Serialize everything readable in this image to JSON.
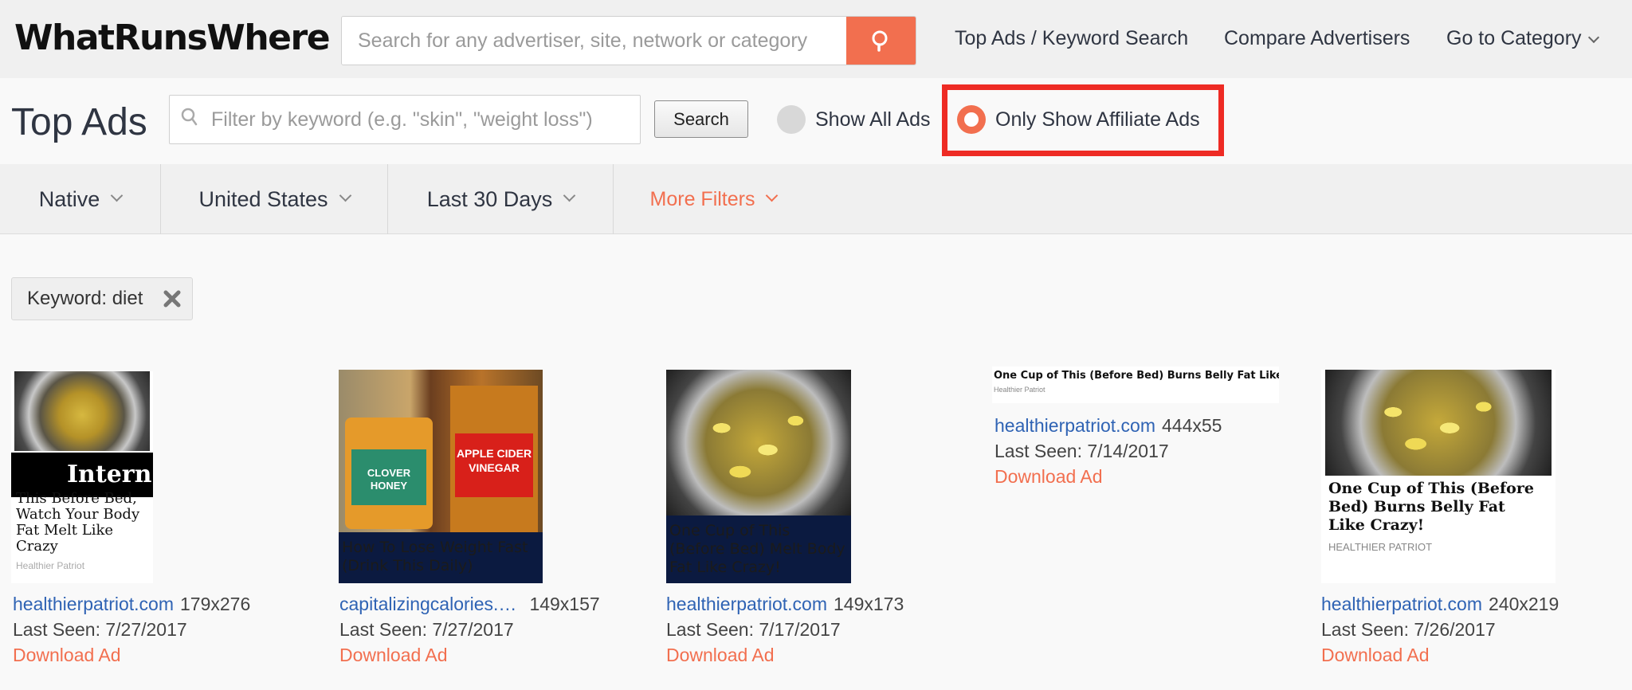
{
  "header": {
    "logo": "WhatRunsWhere",
    "search_placeholder": "Search for any advertiser, site, network or category",
    "nav": [
      "Top Ads / Keyword Search",
      "Compare Advertisers",
      "Go to Category"
    ]
  },
  "toolbar": {
    "title": "Top Ads",
    "filter_placeholder": "Filter by keyword (e.g. \"skin\", \"weight loss\")",
    "search_label": "Search",
    "show_all_label": "Show All Ads",
    "affiliate_label": "Only Show Affiliate Ads",
    "affiliate_selected": true
  },
  "filters": {
    "tabs": [
      "Native",
      "United States",
      "Last 30 Days",
      "More Filters"
    ]
  },
  "active_filter": {
    "label": "Keyword: diet"
  },
  "ads": [
    {
      "domain": "healthierpatriot.com",
      "size": "179x276",
      "last_seen": "Last Seen: 7/27/2017",
      "download": "Download Ad",
      "banner_text": "Intern",
      "headline": "This Before Bed, Watch Your Body Fat Melt Like Crazy",
      "source": "Healthier Patriot"
    },
    {
      "domain": "capitalizingcalories.com",
      "domain_display": "capitalizingcalories.…",
      "size": "149x157",
      "last_seen": "Last Seen: 7/27/2017",
      "download": "Download Ad",
      "headline": "How To Lose Weight Fast (Drink This Daily)",
      "bottle_1": "CLOVER HONEY",
      "bottle_2": "APPLE CIDER VINEGAR"
    },
    {
      "domain": "healthierpatriot.com",
      "size": "149x173",
      "last_seen": "Last Seen: 7/17/2017",
      "download": "Download Ad",
      "headline": "One Cup of This (Before Bed) Melt Body Fat Like Crazy!"
    },
    {
      "domain": "healthierpatriot.com",
      "size": "444x55",
      "last_seen": "Last Seen: 7/14/2017",
      "download": "Download Ad",
      "headline": "One Cup of This (Before Bed) Burns Belly Fat Like Crazy!",
      "source": "Healthier Patriot"
    },
    {
      "domain": "healthierpatriot.com",
      "size": "240x219",
      "last_seen": "Last Seen: 7/26/2017",
      "download": "Download Ad",
      "headline": "One Cup of This (Before Bed) Burns Belly Fat Like Crazy!",
      "source": "HEALTHIER PATRIOT"
    }
  ],
  "colors": {
    "accent": "#f26f4f",
    "link": "#2f63b4",
    "highlight": "#ee2b24",
    "text_dark": "#2f3542"
  }
}
